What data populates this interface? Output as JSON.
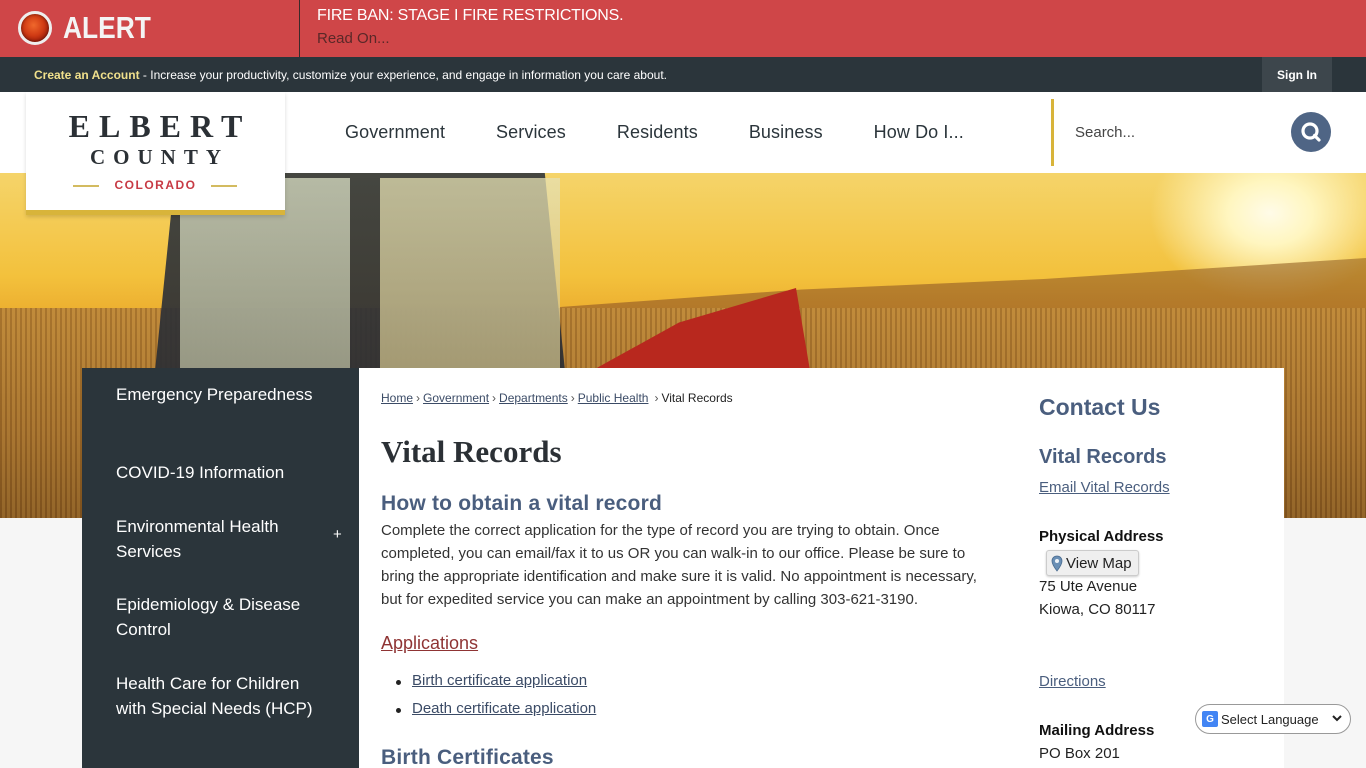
{
  "alert": {
    "label": "ALERT",
    "title": "FIRE BAN: STAGE I FIRE RESTRICTIONS.",
    "link": "Read On...",
    "icon": "alert-dot-icon",
    "color": "#cf4648"
  },
  "account_bar": {
    "create_label": "Create an Account",
    "tagline": " - Increase your productivity, customize your experience, and engage in information you care about.",
    "sign_in": "Sign In"
  },
  "logo": {
    "line1": "ELBERT",
    "line2": "COUNTY",
    "line3": "COLORADO"
  },
  "nav": {
    "items": [
      {
        "label": "Government"
      },
      {
        "label": "Services"
      },
      {
        "label": "Residents"
      },
      {
        "label": "Business"
      },
      {
        "label": "How Do I..."
      }
    ],
    "search_placeholder": "Search...",
    "search_icon": "search-icon"
  },
  "sidebar": {
    "items": [
      {
        "label": "Emergency Preparedness",
        "expandable": false
      },
      {
        "label": "COVID-19 Information",
        "expandable": false
      },
      {
        "label": "Environmental Health Services",
        "expandable": true,
        "expand_symbol": "+"
      },
      {
        "label": "Epidemiology & Disease Control",
        "expandable": false
      },
      {
        "label": "Health Care for Children with Special Needs (HCP)",
        "expandable": false
      }
    ]
  },
  "breadcrumb": {
    "items": [
      "Home",
      "Government",
      "Departments",
      "Public Health"
    ],
    "current": "Vital Records",
    "separator": "›"
  },
  "main": {
    "title": "Vital Records",
    "section1_heading": "How to obtain a vital record",
    "section1_body": "Complete the correct application for the type of record you are trying to obtain. Once completed, you can email/fax it to us OR you can walk-in to our office. Please be sure to bring the appropriate identification and make sure it is valid. No appointment is necessary, but for expedited service you can make an appointment by calling 303-621-3190.",
    "applications_link": "Applications",
    "applications": [
      "Birth certificate application",
      "Death certificate application"
    ],
    "section2_heading": "Birth Certificates"
  },
  "contact": {
    "heading": "Contact Us",
    "department": "Vital Records",
    "email_link": "Email Vital Records",
    "physical_label": "Physical Address",
    "view_map": "View Map",
    "address_line1": "75 Ute Avenue",
    "address_line2": "Kiowa, CO 80117",
    "directions": "Directions",
    "mailing_label": "Mailing Address",
    "mailing_line1": "PO Box 201"
  },
  "language": {
    "selected": "Select Language"
  }
}
